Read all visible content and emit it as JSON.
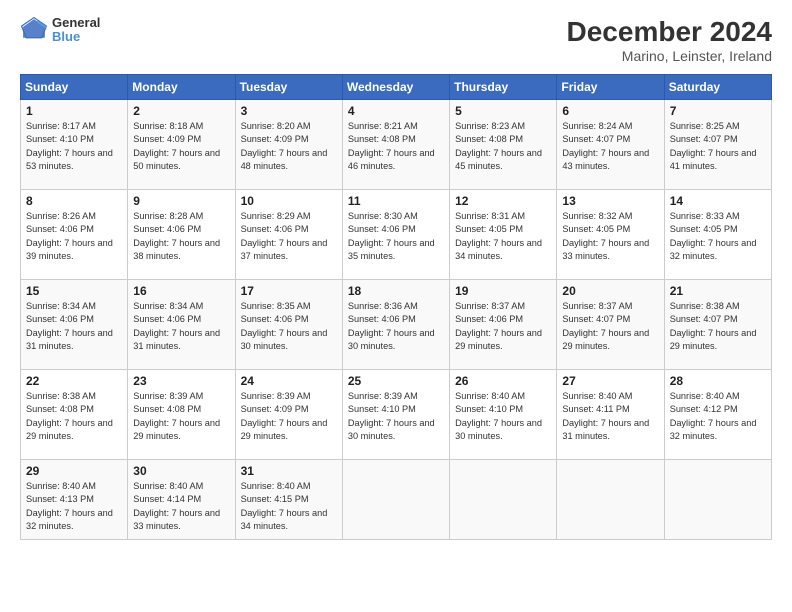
{
  "header": {
    "logo_line1": "General",
    "logo_line2": "Blue",
    "title": "December 2024",
    "subtitle": "Marino, Leinster, Ireland"
  },
  "weekdays": [
    "Sunday",
    "Monday",
    "Tuesday",
    "Wednesday",
    "Thursday",
    "Friday",
    "Saturday"
  ],
  "weeks": [
    [
      {
        "day": "1",
        "sunrise": "8:17 AM",
        "sunset": "4:10 PM",
        "daylight": "7 hours and 53 minutes."
      },
      {
        "day": "2",
        "sunrise": "8:18 AM",
        "sunset": "4:09 PM",
        "daylight": "7 hours and 50 minutes."
      },
      {
        "day": "3",
        "sunrise": "8:20 AM",
        "sunset": "4:09 PM",
        "daylight": "7 hours and 48 minutes."
      },
      {
        "day": "4",
        "sunrise": "8:21 AM",
        "sunset": "4:08 PM",
        "daylight": "7 hours and 46 minutes."
      },
      {
        "day": "5",
        "sunrise": "8:23 AM",
        "sunset": "4:08 PM",
        "daylight": "7 hours and 45 minutes."
      },
      {
        "day": "6",
        "sunrise": "8:24 AM",
        "sunset": "4:07 PM",
        "daylight": "7 hours and 43 minutes."
      },
      {
        "day": "7",
        "sunrise": "8:25 AM",
        "sunset": "4:07 PM",
        "daylight": "7 hours and 41 minutes."
      }
    ],
    [
      {
        "day": "8",
        "sunrise": "8:26 AM",
        "sunset": "4:06 PM",
        "daylight": "7 hours and 39 minutes."
      },
      {
        "day": "9",
        "sunrise": "8:28 AM",
        "sunset": "4:06 PM",
        "daylight": "7 hours and 38 minutes."
      },
      {
        "day": "10",
        "sunrise": "8:29 AM",
        "sunset": "4:06 PM",
        "daylight": "7 hours and 37 minutes."
      },
      {
        "day": "11",
        "sunrise": "8:30 AM",
        "sunset": "4:06 PM",
        "daylight": "7 hours and 35 minutes."
      },
      {
        "day": "12",
        "sunrise": "8:31 AM",
        "sunset": "4:05 PM",
        "daylight": "7 hours and 34 minutes."
      },
      {
        "day": "13",
        "sunrise": "8:32 AM",
        "sunset": "4:05 PM",
        "daylight": "7 hours and 33 minutes."
      },
      {
        "day": "14",
        "sunrise": "8:33 AM",
        "sunset": "4:05 PM",
        "daylight": "7 hours and 32 minutes."
      }
    ],
    [
      {
        "day": "15",
        "sunrise": "8:34 AM",
        "sunset": "4:06 PM",
        "daylight": "7 hours and 31 minutes."
      },
      {
        "day": "16",
        "sunrise": "8:34 AM",
        "sunset": "4:06 PM",
        "daylight": "7 hours and 31 minutes."
      },
      {
        "day": "17",
        "sunrise": "8:35 AM",
        "sunset": "4:06 PM",
        "daylight": "7 hours and 30 minutes."
      },
      {
        "day": "18",
        "sunrise": "8:36 AM",
        "sunset": "4:06 PM",
        "daylight": "7 hours and 30 minutes."
      },
      {
        "day": "19",
        "sunrise": "8:37 AM",
        "sunset": "4:06 PM",
        "daylight": "7 hours and 29 minutes."
      },
      {
        "day": "20",
        "sunrise": "8:37 AM",
        "sunset": "4:07 PM",
        "daylight": "7 hours and 29 minutes."
      },
      {
        "day": "21",
        "sunrise": "8:38 AM",
        "sunset": "4:07 PM",
        "daylight": "7 hours and 29 minutes."
      }
    ],
    [
      {
        "day": "22",
        "sunrise": "8:38 AM",
        "sunset": "4:08 PM",
        "daylight": "7 hours and 29 minutes."
      },
      {
        "day": "23",
        "sunrise": "8:39 AM",
        "sunset": "4:08 PM",
        "daylight": "7 hours and 29 minutes."
      },
      {
        "day": "24",
        "sunrise": "8:39 AM",
        "sunset": "4:09 PM",
        "daylight": "7 hours and 29 minutes."
      },
      {
        "day": "25",
        "sunrise": "8:39 AM",
        "sunset": "4:10 PM",
        "daylight": "7 hours and 30 minutes."
      },
      {
        "day": "26",
        "sunrise": "8:40 AM",
        "sunset": "4:10 PM",
        "daylight": "7 hours and 30 minutes."
      },
      {
        "day": "27",
        "sunrise": "8:40 AM",
        "sunset": "4:11 PM",
        "daylight": "7 hours and 31 minutes."
      },
      {
        "day": "28",
        "sunrise": "8:40 AM",
        "sunset": "4:12 PM",
        "daylight": "7 hours and 32 minutes."
      }
    ],
    [
      {
        "day": "29",
        "sunrise": "8:40 AM",
        "sunset": "4:13 PM",
        "daylight": "7 hours and 32 minutes."
      },
      {
        "day": "30",
        "sunrise": "8:40 AM",
        "sunset": "4:14 PM",
        "daylight": "7 hours and 33 minutes."
      },
      {
        "day": "31",
        "sunrise": "8:40 AM",
        "sunset": "4:15 PM",
        "daylight": "7 hours and 34 minutes."
      },
      null,
      null,
      null,
      null
    ]
  ],
  "labels": {
    "sunrise": "Sunrise:",
    "sunset": "Sunset:",
    "daylight": "Daylight:"
  }
}
